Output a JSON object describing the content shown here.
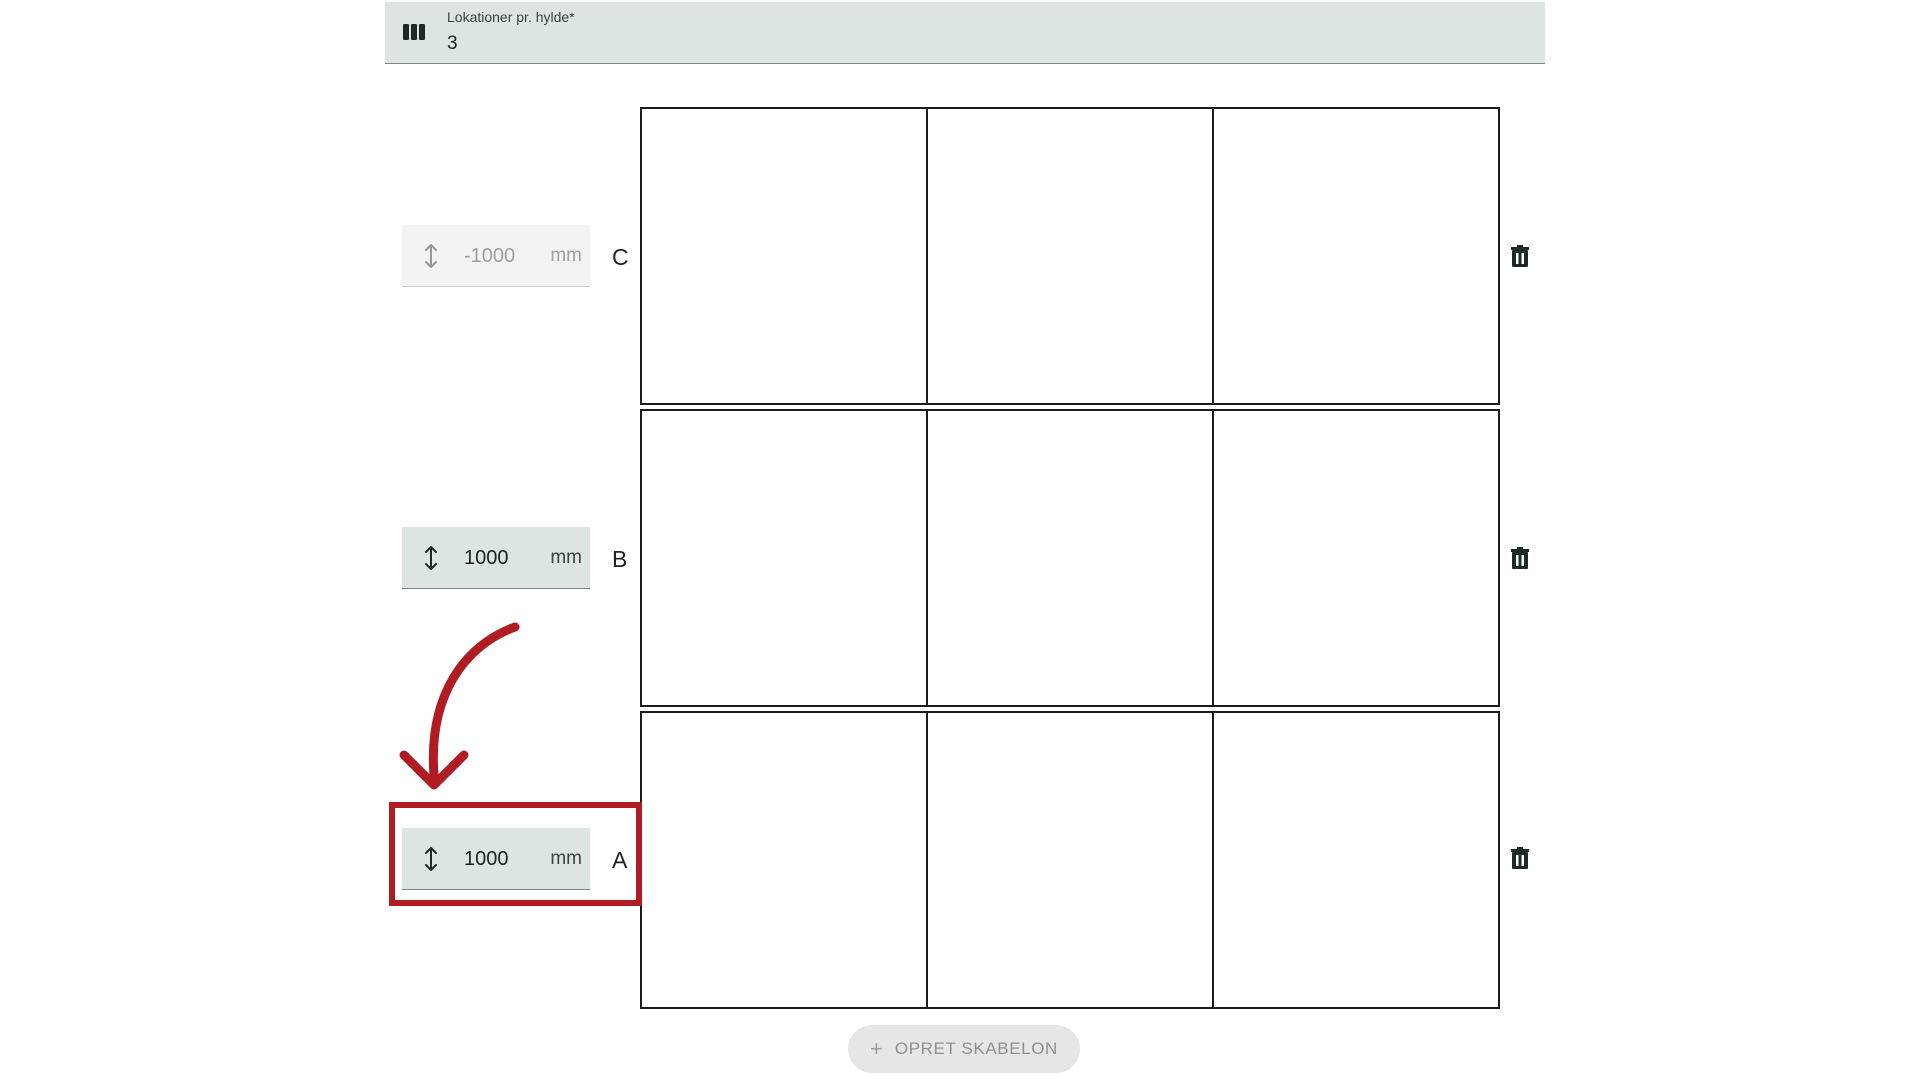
{
  "header_field": {
    "label": "Lokationer pr. hylde*",
    "value": "3",
    "icon": "view-columns-icon"
  },
  "shelf_rows": [
    {
      "letter": "C",
      "height_value": "-1000",
      "unit": "mm",
      "disabled": true,
      "cells": 3
    },
    {
      "letter": "B",
      "height_value": "1000",
      "unit": "mm",
      "disabled": false,
      "cells": 3
    },
    {
      "letter": "A",
      "height_value": "1000",
      "unit": "mm",
      "disabled": false,
      "cells": 3,
      "highlighted": true
    }
  ],
  "row_icons": {
    "height": "vertical-resize-icon",
    "delete": "trash-icon"
  },
  "create_button": {
    "icon": "plus-icon",
    "label": "OPRET SKABELON"
  },
  "annotation": {
    "color": "#b01c22"
  },
  "colors": {
    "field_background": "#dde5e3",
    "grid_line": "#1b1b1b",
    "annotation_red": "#b01c22"
  }
}
